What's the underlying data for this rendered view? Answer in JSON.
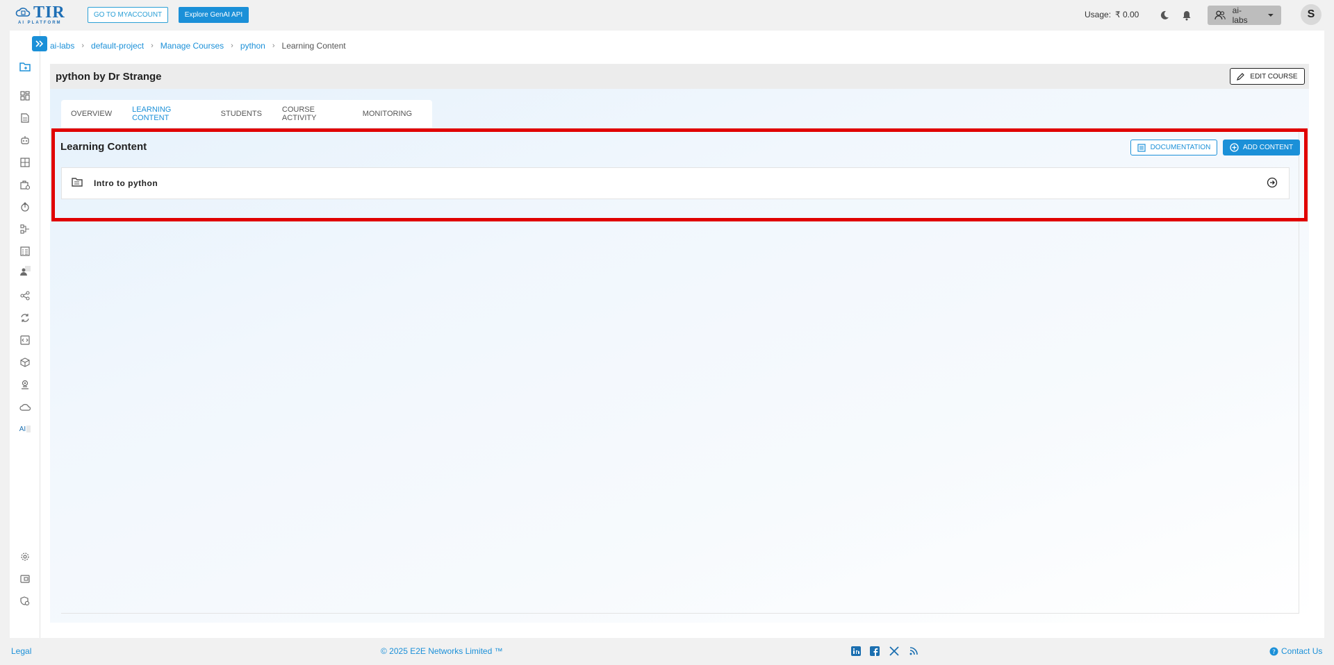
{
  "brand": {
    "name": "TIR",
    "subtitle": "AI PLATFORM"
  },
  "header": {
    "myaccount_label": "GO TO MYACCOUNT",
    "genai_label": "Explore GenAI API",
    "usage_label": "Usage:",
    "usage_value": "₹ 0.00",
    "team_label": "ai-labs",
    "avatar_initial": "S"
  },
  "breadcrumb": {
    "items": [
      "ai-labs",
      "default-project",
      "Manage Courses",
      "python",
      "Learning Content"
    ]
  },
  "course": {
    "title": "python by Dr Strange",
    "edit_label": "EDIT COURSE"
  },
  "tabs": [
    {
      "label": "OVERVIEW",
      "active": false
    },
    {
      "label": "LEARNING CONTENT",
      "active": true
    },
    {
      "label": "STUDENTS",
      "active": false
    },
    {
      "label": "COURSE ACTIVITY",
      "active": false
    },
    {
      "label": "MONITORING",
      "active": false
    }
  ],
  "learning_content": {
    "title": "Learning Content",
    "documentation_label": "DOCUMENTATION",
    "add_label": "ADD CONTENT",
    "items": [
      {
        "label": "Intro to python"
      }
    ]
  },
  "sidebar": {
    "ai_label": "AI"
  },
  "footer": {
    "legal": "Legal",
    "copyright": "© 2025 E2E Networks Limited ™",
    "contact": "Contact Us"
  },
  "colors": {
    "accent": "#1b90d8",
    "highlight": "#e00000"
  }
}
